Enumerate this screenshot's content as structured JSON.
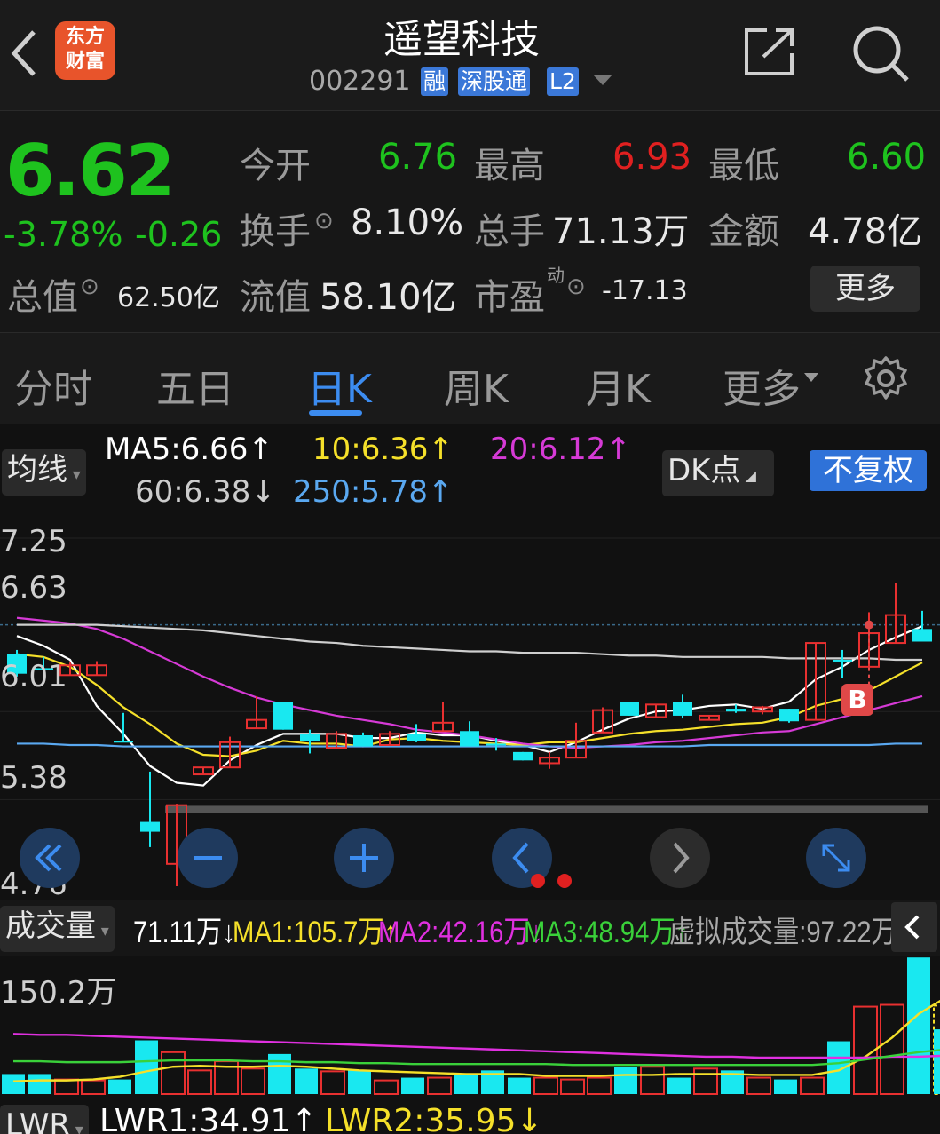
{
  "header": {
    "back_label": "‹",
    "logo_line1": "东方",
    "logo_line2": "财富",
    "stock_name": "遥望科技",
    "stock_code": "002291",
    "tag_margin": "融",
    "tag_connect": "深股通",
    "tag_level": "L2",
    "icons": [
      "back-icon",
      "share-icon",
      "search-icon"
    ]
  },
  "quote": {
    "price": "6.62",
    "change_pct": "-3.78%",
    "change_abs": "-0.26",
    "open_label": "今开",
    "open_value": "6.76",
    "high_label": "最高",
    "high_value": "6.93",
    "low_label": "最低",
    "low_value": "6.60",
    "turnover_label": "换手",
    "turnover_value": "8.10%",
    "volume_label": "总手",
    "volume_value": "71.13万",
    "amount_label": "金额",
    "amount_value": "4.78亿",
    "mktcap_label": "总值",
    "mktcap_value": "62.50亿",
    "float_label": "流值",
    "float_value": "58.10亿",
    "pe_label": "市盈",
    "pe_sup": "动",
    "pe_value": "-17.13",
    "more_button": "更多",
    "colors": {
      "up": "#e02020",
      "down": "#1ec21e"
    }
  },
  "tabs": {
    "items": [
      "分时",
      "五日",
      "日K",
      "周K",
      "月K",
      "更多"
    ],
    "active": "日K"
  },
  "ma_legend": {
    "selector": "均线",
    "ma5": "MA5:6.66↑",
    "ma10": "10:6.36↑",
    "ma20": "20:6.12↑",
    "ma60": "60:6.38↓",
    "ma250": "250:5.78↑",
    "dk_button": "DK点",
    "fq_button": "不复权",
    "colors": {
      "ma5": "#ffffff",
      "ma10": "#f5e02a",
      "ma20": "#d63ad6",
      "ma60": "#cccccc",
      "ma250": "#5aa8f0"
    }
  },
  "kchart": {
    "y_labels": [
      "7.25",
      "6.63",
      "6.01",
      "5.38",
      "4.76"
    ],
    "marker": "B",
    "nav_icons": [
      "rewind-icon",
      "zoom-out-icon",
      "zoom-in-icon",
      "prev-icon",
      "next-icon",
      "fullscreen-icon"
    ]
  },
  "chart_data": {
    "type": "candlestick",
    "ylim": [
      4.76,
      7.25
    ],
    "candles": [
      {
        "o": 6.42,
        "c": 6.28,
        "h": 6.45,
        "l": 6.26
      },
      {
        "o": 6.32,
        "c": 6.31,
        "h": 6.4,
        "l": 6.26
      },
      {
        "o": 6.27,
        "c": 6.34,
        "h": 6.36,
        "l": 6.27
      },
      {
        "o": 6.27,
        "c": 6.34,
        "h": 6.37,
        "l": 6.27
      },
      {
        "o": 5.8,
        "c": 5.79,
        "h": 6.0,
        "l": 5.79
      },
      {
        "o": 5.22,
        "c": 5.15,
        "h": 5.58,
        "l": 5.04
      },
      {
        "o": 4.92,
        "c": 5.34,
        "h": 5.35,
        "l": 4.76
      },
      {
        "o": 5.56,
        "c": 5.61,
        "h": 5.61,
        "l": 5.56
      },
      {
        "o": 5.61,
        "c": 5.79,
        "h": 5.83,
        "l": 5.61
      },
      {
        "o": 5.89,
        "c": 5.95,
        "h": 6.12,
        "l": 5.89
      },
      {
        "o": 6.08,
        "c": 5.88,
        "h": 6.08,
        "l": 5.88
      },
      {
        "o": 5.85,
        "c": 5.8,
        "h": 5.88,
        "l": 5.71
      },
      {
        "o": 5.75,
        "c": 5.85,
        "h": 5.87,
        "l": 5.75
      },
      {
        "o": 5.84,
        "c": 5.76,
        "h": 5.86,
        "l": 5.76
      },
      {
        "o": 5.77,
        "c": 5.85,
        "h": 5.87,
        "l": 5.77
      },
      {
        "o": 5.85,
        "c": 5.8,
        "h": 5.92,
        "l": 5.79
      },
      {
        "o": 5.87,
        "c": 5.93,
        "h": 6.08,
        "l": 5.87
      },
      {
        "o": 5.87,
        "c": 5.76,
        "h": 5.94,
        "l": 5.76
      },
      {
        "o": 5.78,
        "c": 5.77,
        "h": 5.82,
        "l": 5.73
      },
      {
        "o": 5.72,
        "c": 5.66,
        "h": 5.72,
        "l": 5.66
      },
      {
        "o": 5.64,
        "c": 5.68,
        "h": 5.72,
        "l": 5.6
      },
      {
        "o": 5.68,
        "c": 5.8,
        "h": 5.93,
        "l": 5.68
      },
      {
        "o": 5.86,
        "c": 6.02,
        "h": 6.04,
        "l": 5.86
      },
      {
        "o": 6.08,
        "c": 5.98,
        "h": 6.08,
        "l": 5.98
      },
      {
        "o": 5.97,
        "c": 6.06,
        "h": 6.06,
        "l": 5.97
      },
      {
        "o": 6.08,
        "c": 5.98,
        "h": 6.13,
        "l": 5.96
      },
      {
        "o": 5.95,
        "c": 5.98,
        "h": 5.98,
        "l": 5.95
      },
      {
        "o": 6.03,
        "c": 6.01,
        "h": 6.06,
        "l": 6.0
      },
      {
        "o": 6.01,
        "c": 6.04,
        "h": 6.05,
        "l": 5.99
      },
      {
        "o": 6.03,
        "c": 5.94,
        "h": 6.03,
        "l": 5.93
      },
      {
        "o": 5.95,
        "c": 6.5,
        "h": 6.5,
        "l": 5.95
      },
      {
        "o": 6.38,
        "c": 6.37,
        "h": 6.45,
        "l": 6.25
      },
      {
        "o": 6.33,
        "c": 6.57,
        "h": 6.72,
        "l": 6.33
      },
      {
        "o": 6.5,
        "c": 6.7,
        "h": 6.93,
        "l": 6.5
      },
      {
        "o": 6.6,
        "c": 6.51,
        "h": 6.73,
        "l": 6.51
      }
    ],
    "ma_series": [
      {
        "name": "MA5",
        "values": [
          6.55,
          6.48,
          6.38,
          6.05,
          5.85,
          5.62,
          5.5,
          5.48,
          5.66,
          5.77,
          5.85,
          5.85,
          5.85,
          5.82,
          5.82,
          5.86,
          5.84,
          5.84,
          5.8,
          5.77,
          5.72,
          5.79,
          5.88,
          5.96,
          6.01,
          6.02,
          6.05,
          6.06,
          6.03,
          6.08,
          6.24,
          6.33,
          6.45,
          6.54,
          6.62
        ]
      },
      {
        "name": "10",
        "values": [
          6.42,
          6.4,
          6.33,
          6.2,
          6.04,
          5.92,
          5.78,
          5.7,
          5.69,
          5.73,
          5.8,
          5.78,
          5.78,
          5.76,
          5.81,
          5.82,
          5.8,
          5.79,
          5.78,
          5.77,
          5.79,
          5.79,
          5.82,
          5.85,
          5.87,
          5.88,
          5.9,
          5.92,
          5.93,
          5.97,
          6.05,
          6.1,
          6.16,
          6.26,
          6.36
        ]
      },
      {
        "name": "20",
        "values": [
          6.68,
          6.66,
          6.64,
          6.6,
          6.53,
          6.44,
          6.35,
          6.26,
          6.18,
          6.11,
          6.06,
          6.02,
          5.98,
          5.95,
          5.92,
          5.88,
          5.86,
          5.84,
          5.81,
          5.78,
          5.76,
          5.75,
          5.76,
          5.77,
          5.79,
          5.8,
          5.82,
          5.84,
          5.86,
          5.87,
          5.92,
          5.97,
          6.02,
          6.07,
          6.12
        ]
      },
      {
        "name": "60",
        "values": [
          6.63,
          6.63,
          6.63,
          6.63,
          6.62,
          6.61,
          6.6,
          6.59,
          6.57,
          6.55,
          6.53,
          6.51,
          6.5,
          6.48,
          6.47,
          6.46,
          6.45,
          6.44,
          6.44,
          6.43,
          6.43,
          6.43,
          6.42,
          6.41,
          6.41,
          6.4,
          6.4,
          6.4,
          6.4,
          6.39,
          6.39,
          6.39,
          6.39,
          6.38,
          6.38
        ]
      },
      {
        "name": "250",
        "values": [
          5.78,
          5.78,
          5.77,
          5.77,
          5.76,
          5.76,
          5.76,
          5.76,
          5.76,
          5.76,
          5.76,
          5.76,
          5.76,
          5.76,
          5.76,
          5.76,
          5.76,
          5.76,
          5.76,
          5.76,
          5.76,
          5.76,
          5.76,
          5.76,
          5.76,
          5.76,
          5.77,
          5.77,
          5.77,
          5.77,
          5.77,
          5.77,
          5.77,
          5.78,
          5.78
        ]
      }
    ],
    "volume": {
      "ylim_max": 150.2,
      "values": [
        22,
        22,
        16,
        15,
        16,
        59,
        46,
        26,
        36,
        28,
        44,
        28,
        25,
        26,
        15,
        18,
        18,
        22,
        26,
        18,
        18,
        16,
        18,
        30,
        30,
        18,
        28,
        26,
        18,
        16,
        18,
        58,
        96,
        98,
        150,
        71.11
      ]
    },
    "volume_ma": [
      {
        "name": "MA1",
        "values": [
          14,
          15,
          15,
          16,
          19,
          25,
          30,
          31,
          30,
          30,
          31,
          30,
          28,
          26,
          25,
          24,
          23,
          22,
          22,
          22,
          20,
          20,
          20,
          21,
          21,
          22,
          22,
          22,
          21,
          21,
          21,
          26,
          41,
          62,
          88,
          105.7
        ]
      },
      {
        "name": "MA2",
        "values": [
          66,
          65,
          65,
          64,
          63,
          62,
          61,
          60,
          59,
          58,
          57,
          56,
          55,
          54,
          53,
          52,
          51,
          50,
          49,
          48,
          47,
          46,
          45,
          44,
          43,
          42,
          41,
          41,
          40,
          40,
          40,
          40,
          40,
          41,
          41,
          42.16
        ]
      },
      {
        "name": "MA3",
        "values": [
          36,
          36,
          35,
          35,
          35,
          36,
          37,
          37,
          37,
          36,
          36,
          35,
          35,
          34,
          34,
          33,
          33,
          33,
          33,
          33,
          33,
          32,
          32,
          32,
          32,
          32,
          32,
          32,
          32,
          32,
          32,
          34,
          38,
          42,
          46,
          48.94
        ]
      }
    ]
  },
  "volume_legend": {
    "selector": "成交量",
    "vol": "71.11万↓",
    "ma1": "MA1:105.7万↑",
    "ma2": "MA2:42.16万↓",
    "ma3": "MA3:48.94万↑",
    "virtual": "虚拟成交量:97.22万",
    "y_label": "150.2万",
    "collapse_icon": "chevron-left-icon",
    "colors": {
      "ma1": "#f5e02a",
      "ma2": "#e030e0",
      "ma3": "#3ad13a",
      "virtual": "#aaaaaa"
    }
  },
  "lwr": {
    "selector": "LWR",
    "lwr1": "LWR1:34.91↑",
    "lwr2": "LWR2:35.95↓"
  }
}
